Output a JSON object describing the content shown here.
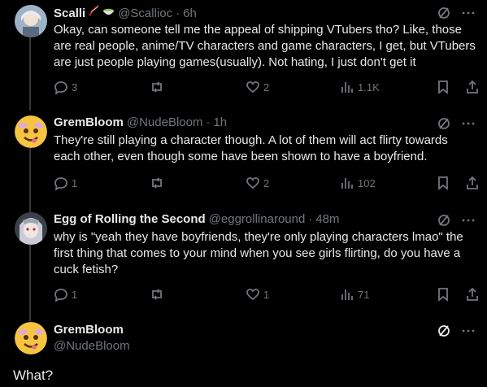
{
  "tweets": [
    {
      "name": "Scalli",
      "handle": "@Scallioc",
      "dot": "·",
      "time": "6h",
      "text": "Okay, can someone tell me the appeal of shipping VTubers tho? Like, those are real people, anime/TV characters and game characters, I get, but VTubers are just people playing games(usually). Not hating, I just don't get it",
      "replies": "3",
      "retweets": "",
      "likes": "2",
      "views": "1.1K"
    },
    {
      "name": "GremBloom",
      "handle": "@NudeBloom",
      "dot": "·",
      "time": "1h",
      "text": "They're still playing a character though. A lot of them will act flirty towards each other, even though some have been shown to have a boyfriend.",
      "replies": "1",
      "retweets": "",
      "likes": "2",
      "views": "102"
    },
    {
      "name": "Egg of Rolling the Second",
      "handle": "@eggrollinaround",
      "dot": "·",
      "time": "48m",
      "text": "why is \"yeah they have boyfriends, they're only playing characters lmao\" the first thing that comes to your mind when you see girls flirting, do you have a cuck fetish?",
      "replies": "1",
      "retweets": "",
      "likes": "1",
      "views": "71"
    }
  ],
  "reply": {
    "name": "GremBloom",
    "handle": "@NudeBloom",
    "text": "What?"
  },
  "colors": {
    "background": "#000000",
    "text": "#e7e9ea",
    "muted": "#71767b",
    "line": "#333639"
  }
}
